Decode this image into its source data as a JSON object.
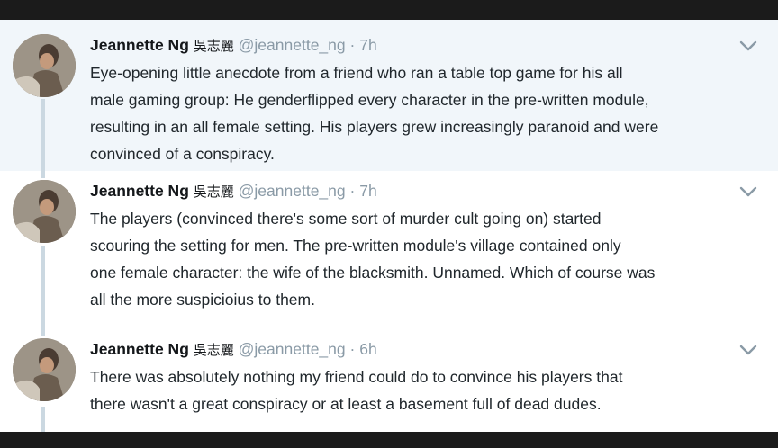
{
  "tweets": [
    {
      "author_name": "Jeannette Ng",
      "cjk_name": "吳志麗",
      "handle": "@jeannette_ng",
      "time": "7h",
      "lines": [
        "Eye-opening little anecdote from a friend who ran a table top game for his all",
        "male gaming group: He genderflipped every character in the pre-written module,",
        "resulting in an all female setting. His players grew increasingly paranoid and were",
        "convinced of a conspiracy."
      ]
    },
    {
      "author_name": "Jeannette Ng",
      "cjk_name": "吳志麗",
      "handle": "@jeannette_ng",
      "time": "7h",
      "lines": [
        "The players (convinced there's some sort of murder cult going on) started",
        "scouring the setting for men. The pre-written module's village contained only",
        "one female character: the wife of the blacksmith. Unnamed. Which of course was",
        "all the more suspicioius to them."
      ]
    },
    {
      "author_name": "Jeannette Ng",
      "cjk_name": "吳志麗",
      "handle": "@jeannette_ng",
      "time": "6h",
      "lines": [
        "There was absolutely nothing my friend could do to convince his players that",
        "there wasn't a great conspiracy or at least a basement full of dead dudes."
      ]
    }
  ],
  "meta_separator": "·",
  "icons": {
    "menu": "chevron-down-icon",
    "avatar": "profile-photo"
  },
  "colors": {
    "highlight_bg": "#f1f6fa",
    "name": "#14171a",
    "handle": "#8a9aa6",
    "body_text": "#20272c",
    "thread_line": "#cbd8e1"
  }
}
